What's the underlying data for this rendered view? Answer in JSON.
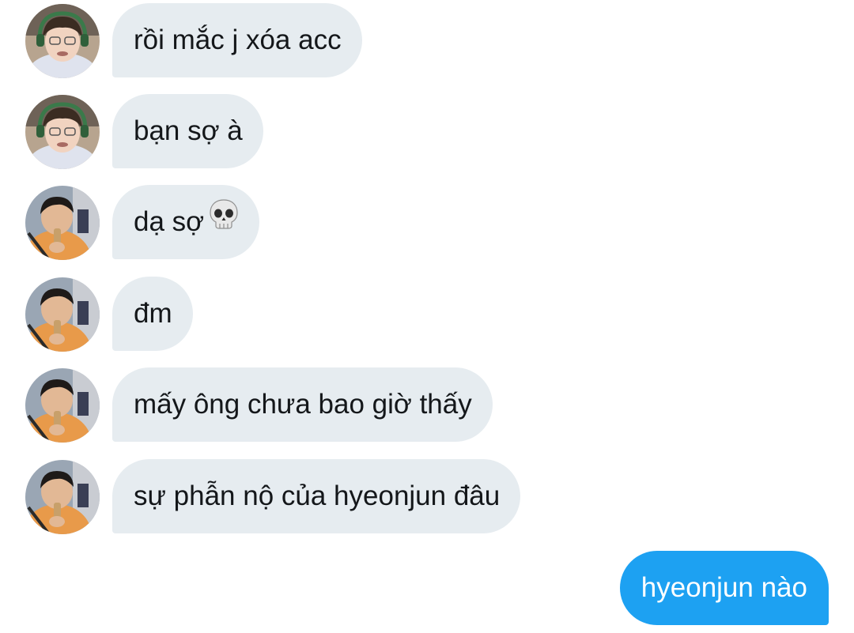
{
  "conversation": {
    "messages": [
      {
        "sender": "avatar-a",
        "text": "rồi mắc j xóa acc"
      },
      {
        "sender": "avatar-a",
        "text": "bạn sợ à"
      },
      {
        "sender": "avatar-b",
        "text": "dạ sợ",
        "emoji": "skull-icon"
      },
      {
        "sender": "avatar-b",
        "text": "đm"
      },
      {
        "sender": "avatar-b",
        "text": "mấy ông chưa bao giờ thấy"
      },
      {
        "sender": "avatar-b",
        "text": "sự phẫn nộ của hyeonjun đâu"
      }
    ],
    "outgoing": {
      "text": "hyeonjun nào"
    }
  },
  "colors": {
    "incoming_bubble": "#e6ecf0",
    "incoming_text": "#14171a",
    "outgoing_bubble": "#1da1f2",
    "outgoing_text": "#ffffff",
    "background": "#ffffff"
  }
}
